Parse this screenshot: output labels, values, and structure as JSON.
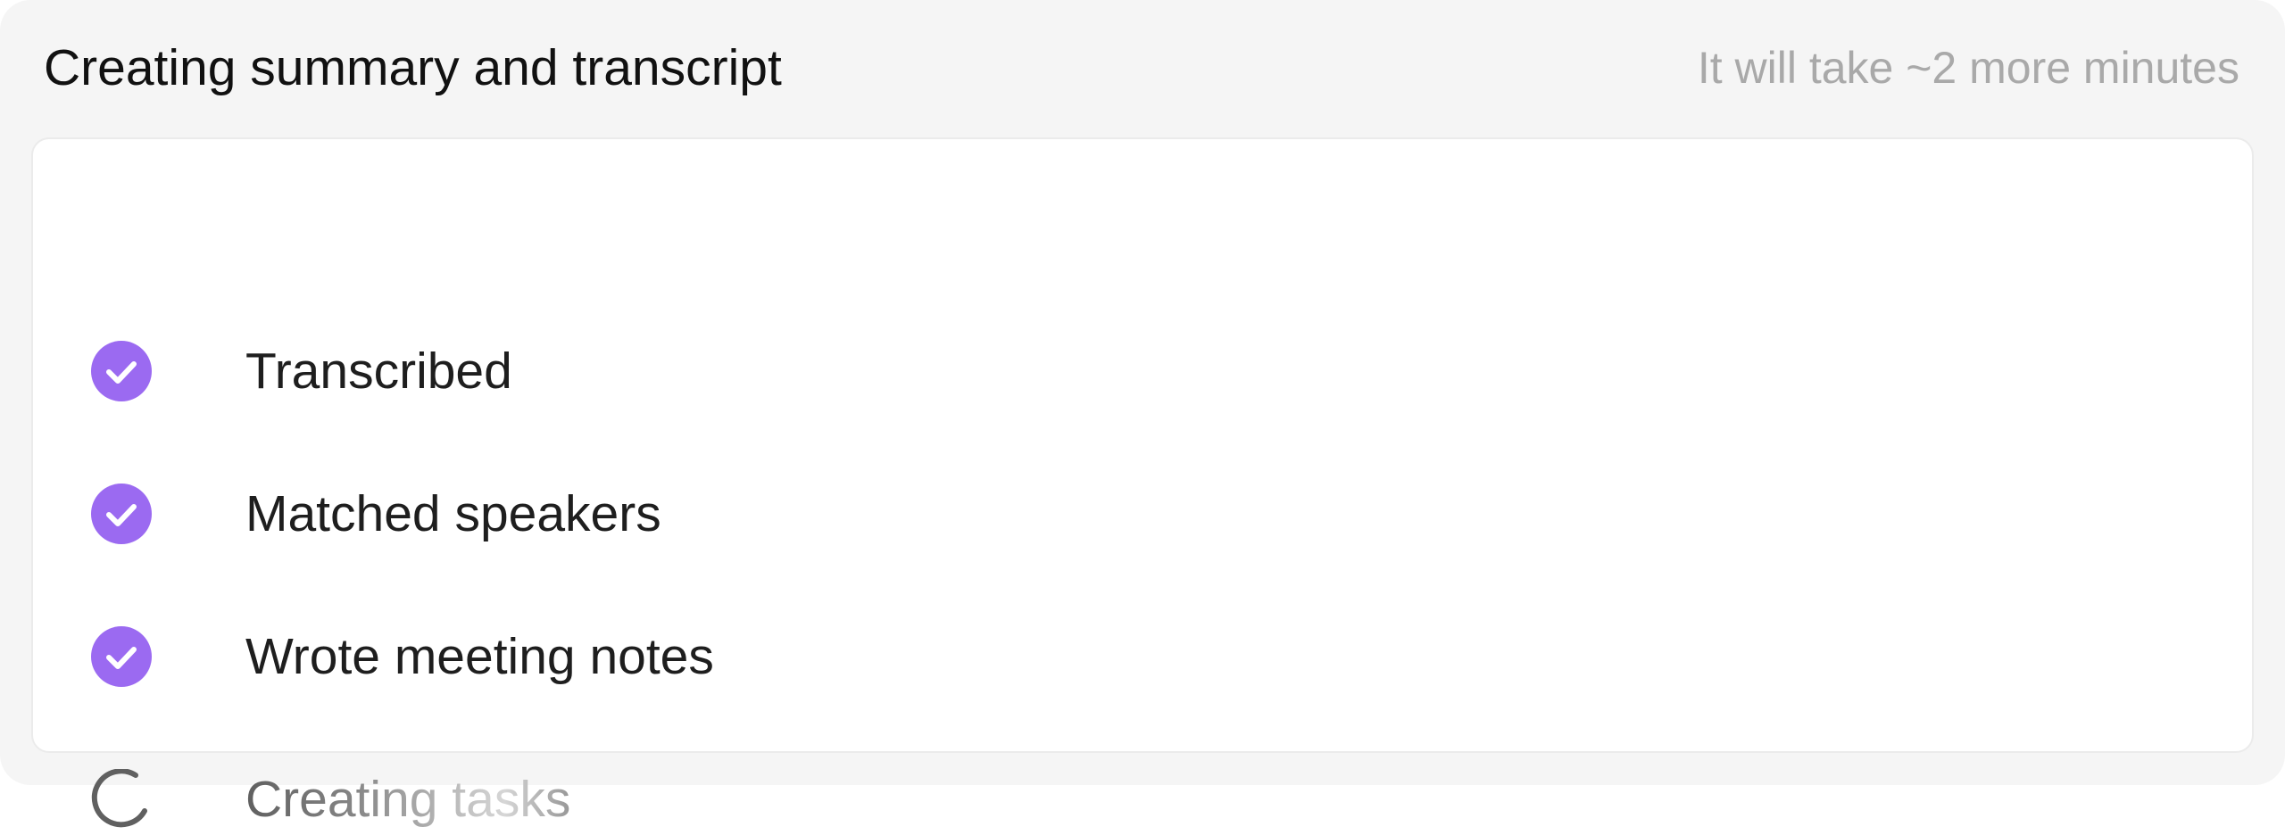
{
  "header": {
    "title": "Creating summary and transcript",
    "eta": "It will take ~2 more minutes"
  },
  "colors": {
    "accent": "#9b6af1",
    "spinner": "#606060",
    "panel_bg": "#f5f5f5",
    "card_bg": "#ffffff"
  },
  "steps": [
    {
      "label": "Transcribed",
      "status": "done",
      "icon": "check-circle-icon"
    },
    {
      "label": "Matched speakers",
      "status": "done",
      "icon": "check-circle-icon"
    },
    {
      "label": "Wrote meeting notes",
      "status": "done",
      "icon": "check-circle-icon"
    },
    {
      "label": "Creating tasks",
      "status": "in-progress",
      "icon": "spinner-icon"
    }
  ]
}
